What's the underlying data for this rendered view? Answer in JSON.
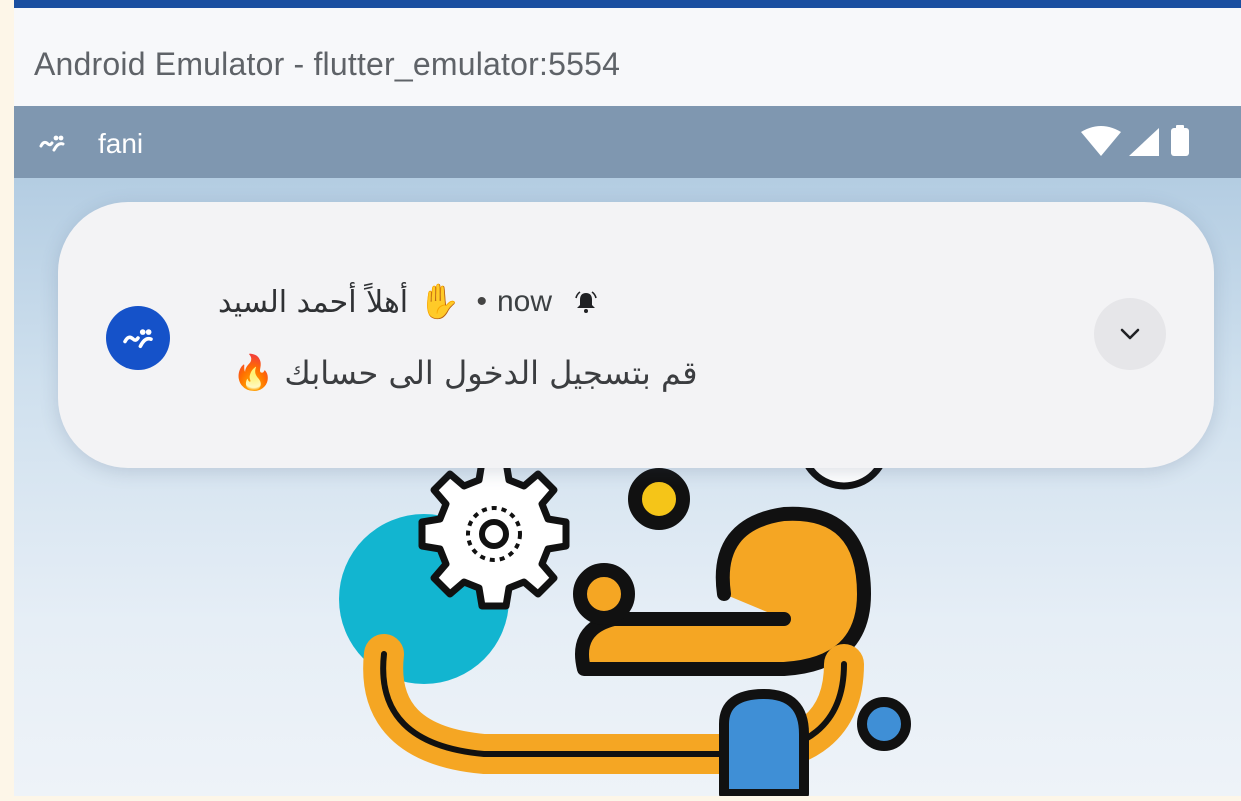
{
  "window": {
    "title": "Android Emulator - flutter_emulator:5554"
  },
  "status_bar": {
    "app_name": "fani",
    "icons": [
      "app-logo-icon",
      "wifi-icon",
      "cellular-signal-icon",
      "battery-icon"
    ]
  },
  "notification": {
    "title": "أهلاً أحمد السيد",
    "title_emoji": "✋",
    "separator": "•",
    "time": "now",
    "body": "قم بتسجيل الدخول الى حسابك",
    "body_emoji": "🔥",
    "icons": [
      "app-avatar-icon",
      "bell-icon",
      "chevron-down-icon"
    ]
  },
  "colors": {
    "status_bar": "#7f97b0",
    "avatar": "#1552c9",
    "notification_bg": "#f3f3f5",
    "logo_orange": "#f5a623",
    "logo_teal": "#12b5d0",
    "logo_blue": "#3f8fd6"
  }
}
